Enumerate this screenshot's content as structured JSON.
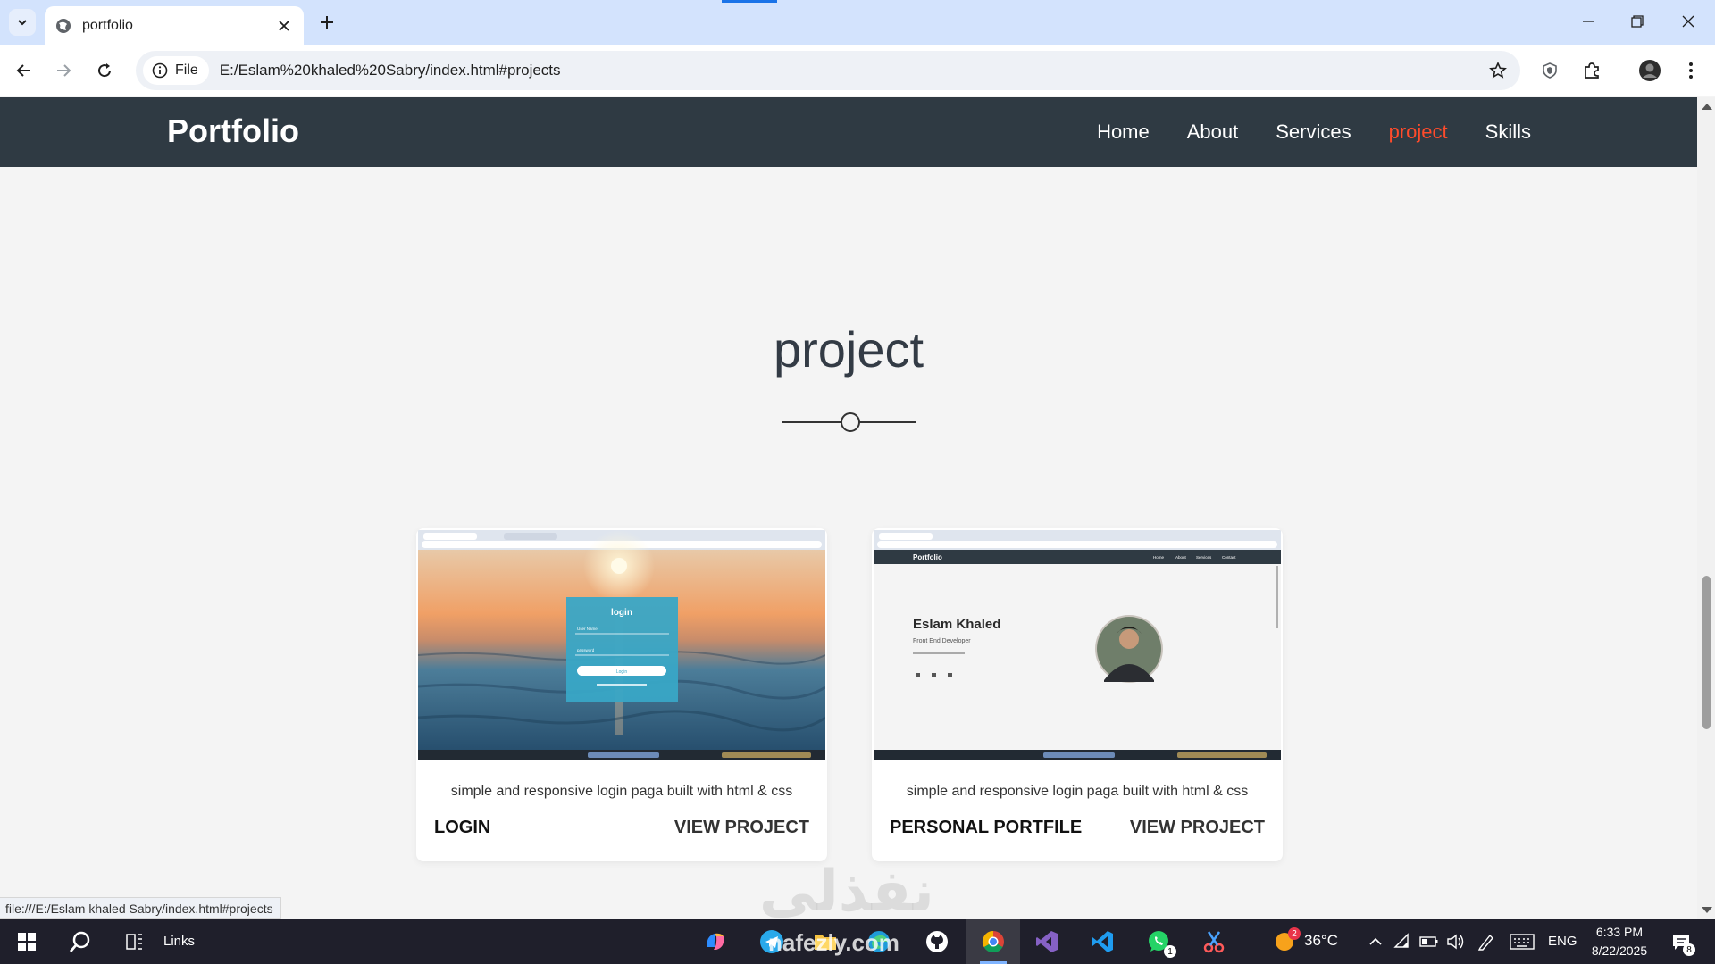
{
  "browser": {
    "tab_title": "portfolio",
    "url_scheme_label": "File",
    "url": "E:/Eslam%20khaled%20Sabry/index.html#projects",
    "status_url": "file:///E:/Eslam khaled Sabry/index.html#projects"
  },
  "site": {
    "logo": "Portfolio",
    "nav": [
      {
        "label": "Home"
      },
      {
        "label": "About"
      },
      {
        "label": "Services"
      },
      {
        "label": "project"
      },
      {
        "label": "Skills"
      }
    ],
    "active_nav": "project",
    "accent_color": "#ff4b2b",
    "nav_bg": "#2f3a43"
  },
  "projects_section": {
    "title": "project",
    "cards": [
      {
        "description": "simple and responsive login paga built with html & css",
        "name": "LOGIN",
        "link_label": "VIEW PROJECT",
        "thumb": {
          "form_title": "login",
          "field1": "User Name",
          "field2": "password",
          "button": "Login"
        }
      },
      {
        "description": "simple and responsive login paga built with html & css",
        "name": "PERSONAL PORTFILE",
        "link_label": "VIEW PROJECT",
        "thumb": {
          "logo": "Portfolio",
          "nav": [
            "Home",
            "About",
            "Services",
            "Contact"
          ],
          "heading": "Eslam Khaled",
          "subheading": "Front End Developer"
        }
      }
    ]
  },
  "watermark": "نفذلي",
  "taskbar": {
    "links_label": "Links",
    "weather": "36°C",
    "language": "ENG",
    "time": "6:33 PM",
    "date": "8/22/2025",
    "notification_count": "8",
    "weather_badge": "2",
    "whatsapp_badge": "1",
    "overlay_text": "nafezly.com"
  }
}
